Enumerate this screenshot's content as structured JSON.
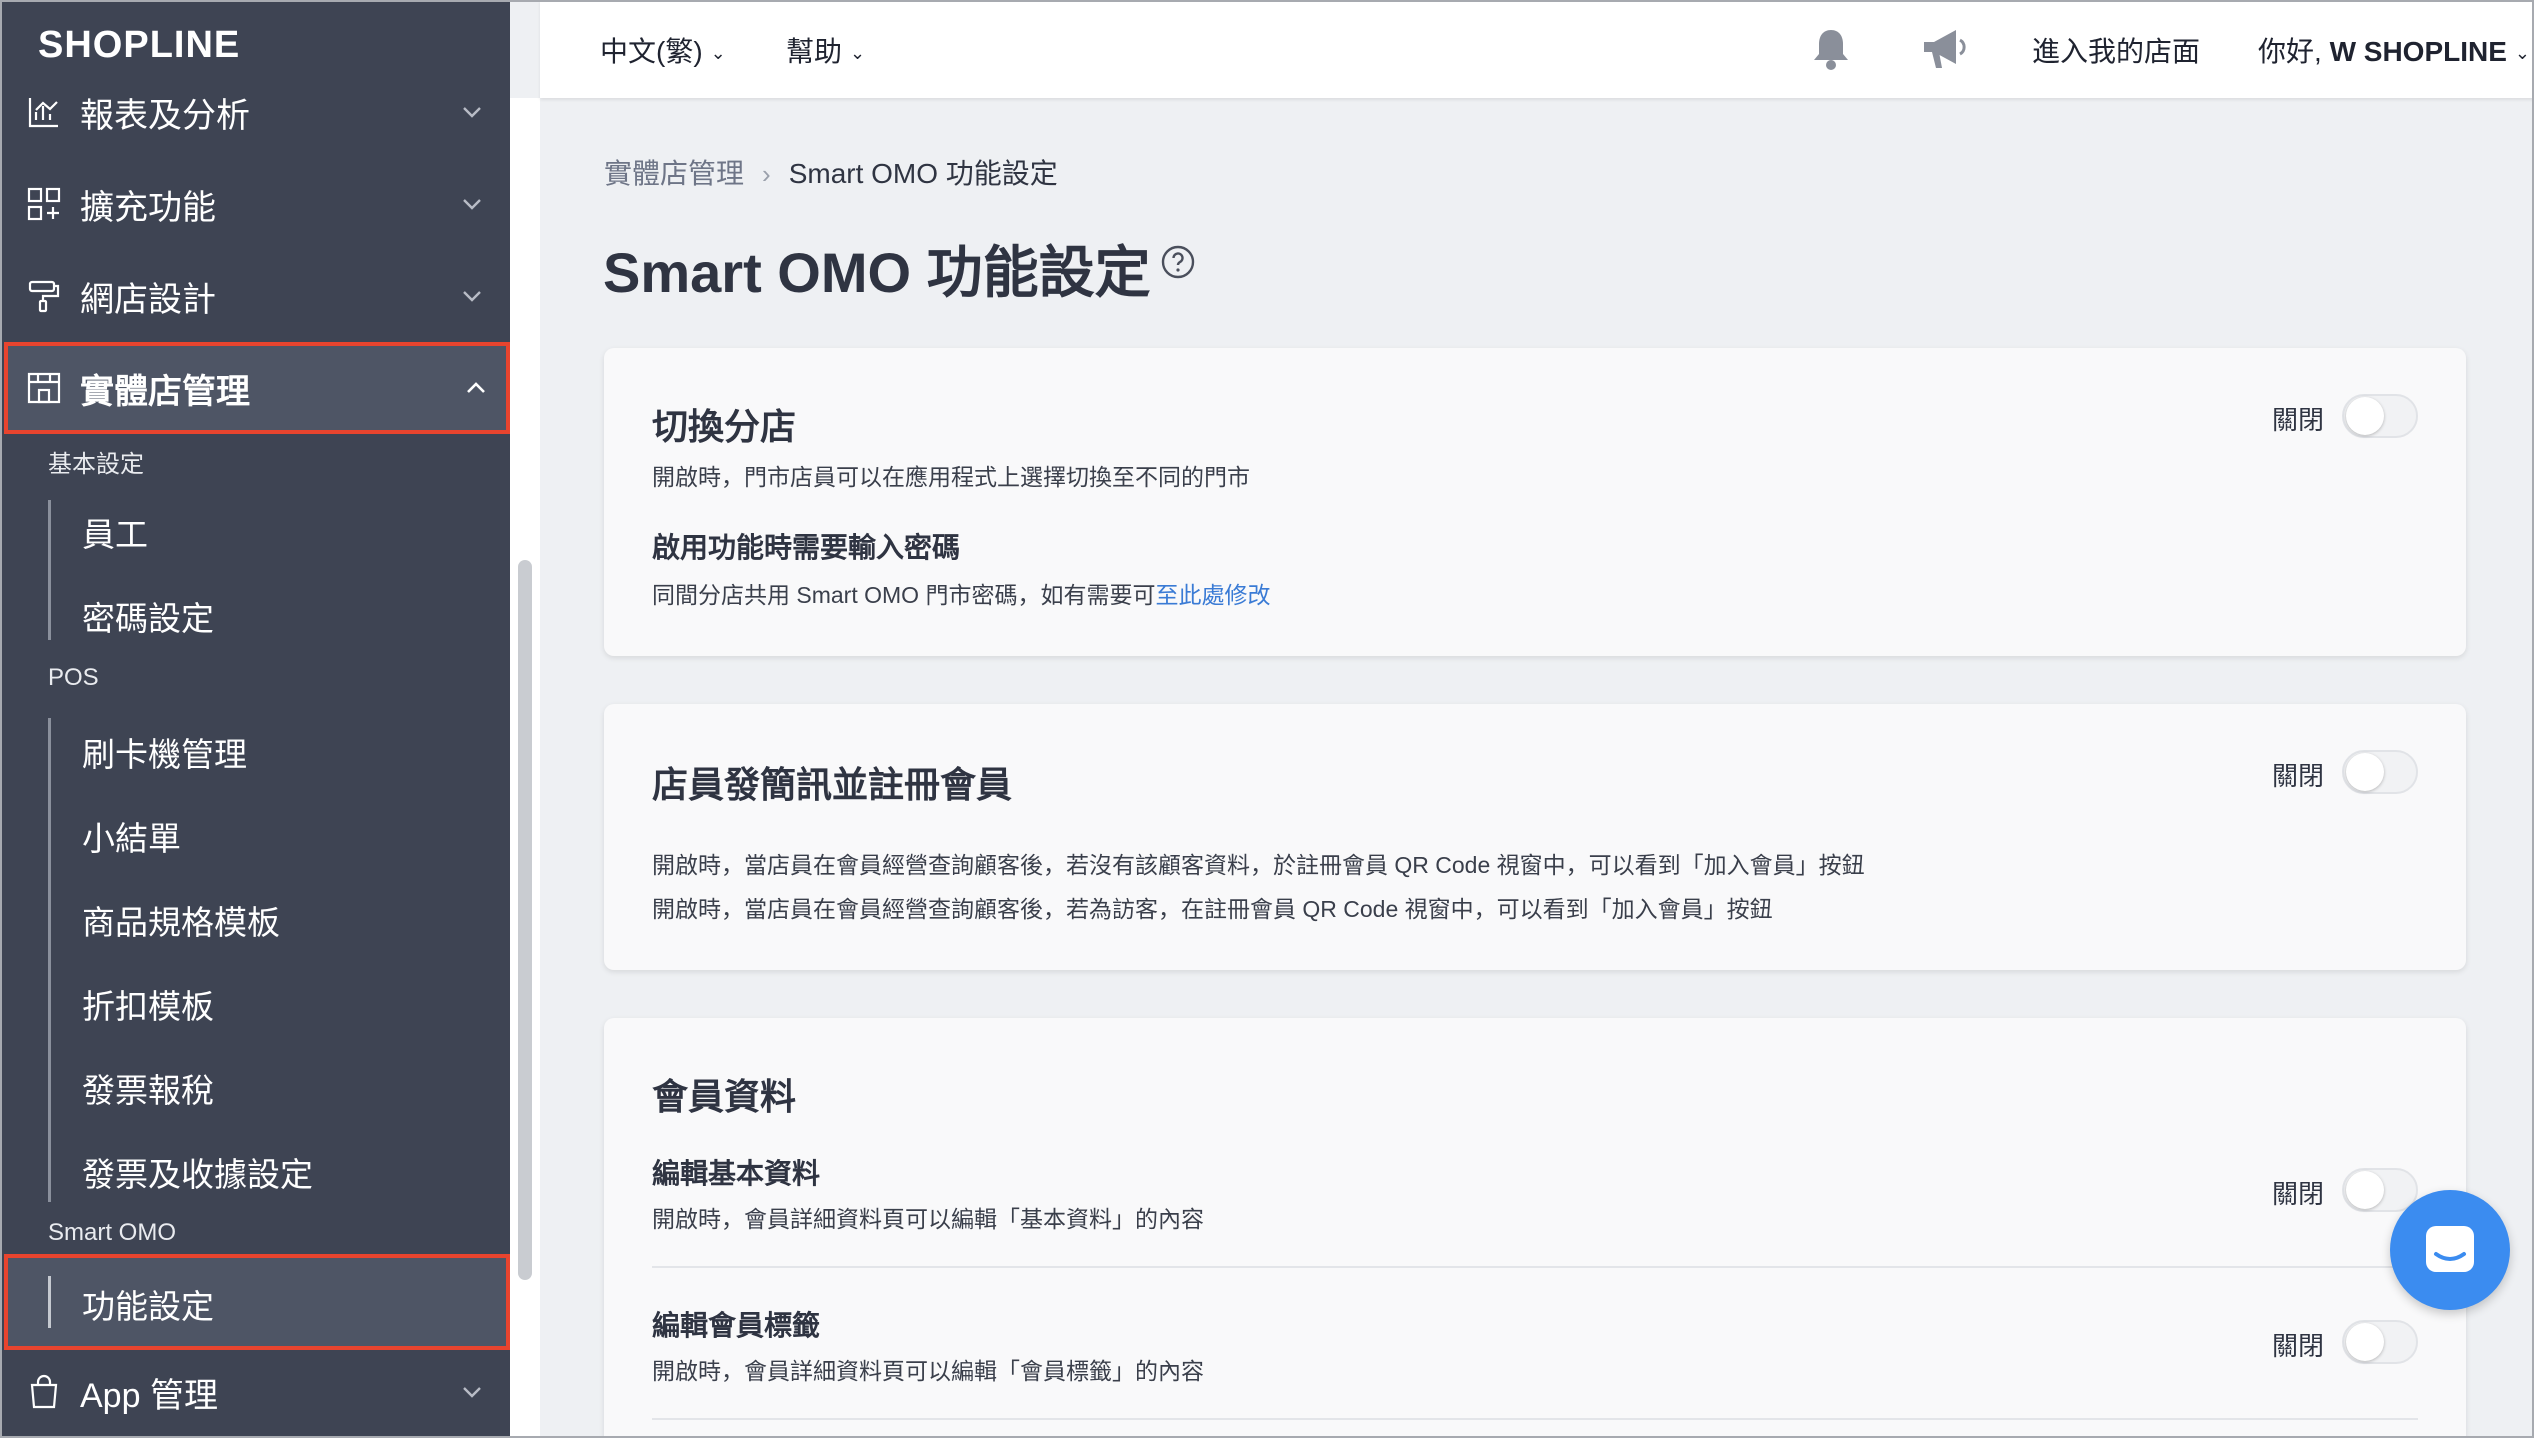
{
  "brand": {
    "logo_text": "SHOPLINE"
  },
  "sidebar": {
    "nav": [
      {
        "label": "報表及分析",
        "icon": "chart-icon"
      },
      {
        "label": "擴充功能",
        "icon": "apps-icon"
      },
      {
        "label": "網店設計",
        "icon": "paint-roller-icon"
      },
      {
        "label": "實體店管理",
        "icon": "store-icon"
      },
      {
        "label": "App 管理",
        "icon": "shopping-bag-icon"
      }
    ],
    "sections": [
      {
        "title": "基本設定",
        "items": [
          "員工",
          "密碼設定"
        ]
      },
      {
        "title": "POS",
        "items": [
          "刷卡機管理",
          "小結單",
          "商品規格模板",
          "折扣模板",
          "發票報稅",
          "發票及收據設定"
        ]
      },
      {
        "title": "Smart OMO",
        "items": [
          "功能設定"
        ]
      }
    ]
  },
  "topbar": {
    "language": "中文(繁)",
    "help": "幫助",
    "enter_store": "進入我的店面",
    "greeting_prefix": "你好, ",
    "greeting_name": "W SHOPLINE"
  },
  "breadcrumb": {
    "parent": "實體店管理",
    "current": "Smart OMO 功能設定"
  },
  "page": {
    "title": "Smart OMO 功能設定"
  },
  "cards": {
    "switch_branch": {
      "title": "切換分店",
      "desc": "開啟時，門市店員可以在應用程式上選擇切換至不同的門市",
      "toggle_label": "關閉",
      "password_title": "啟用功能時需要輸入密碼",
      "password_desc": "同間分店共用 Smart OMO 門市密碼，如有需要可",
      "password_link": "至此處修改"
    },
    "sms_register": {
      "title": "店員發簡訊並註冊會員",
      "toggle_label": "關閉",
      "desc_1": "開啟時，當店員在會員經營查詢顧客後，若沒有該顧客資料，於註冊會員 QR Code 視窗中，可以看到「加入會員」按鈕",
      "desc_2": "開啟時，當店員在會員經營查詢顧客後，若為訪客，在註冊會員 QR Code 視窗中，可以看到「加入會員」按鈕"
    },
    "member_data": {
      "title": "會員資料",
      "rows": [
        {
          "title": "編輯基本資料",
          "desc": "開啟時，會員詳細資料頁可以編輯「基本資料」的內容",
          "toggle_label": "關閉"
        },
        {
          "title": "編輯會員標籤",
          "desc": "開啟時，會員詳細資料頁可以編輯「會員標籤」的內容",
          "toggle_label": "關閉"
        }
      ]
    }
  },
  "colors": {
    "sidebar_bg": "#3e4453",
    "highlight": "#e8442e",
    "link": "#3a7bd5",
    "chat": "#3b8cf0"
  }
}
